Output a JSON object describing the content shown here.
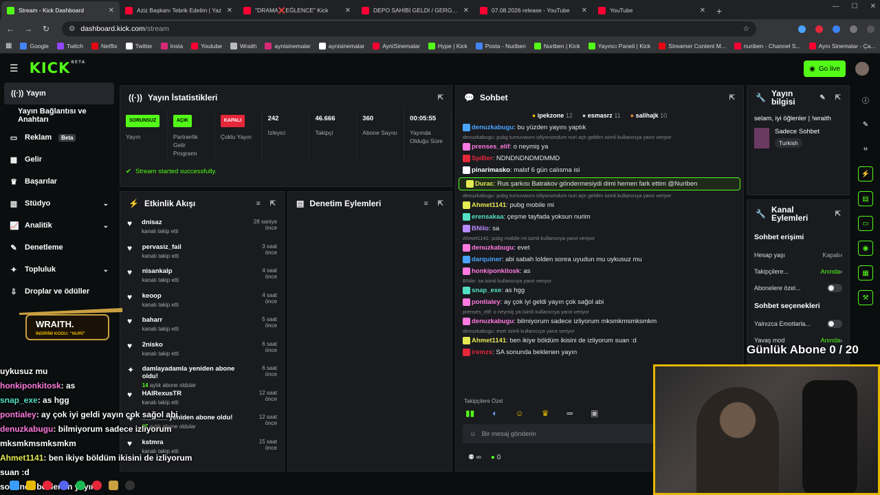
{
  "browser": {
    "tabs": [
      {
        "title": "Stream - Kick Dashboard",
        "active": true,
        "color": "#53fc18"
      },
      {
        "title": "Aziz Başkanı Tebrik Edelim | Yaz",
        "active": false,
        "color": "#ff0033"
      },
      {
        "title": "\"DRAMA❌EĞLENCE\" Kick",
        "active": false,
        "color": "#ff0033"
      },
      {
        "title": "DEPO SAHİBİ GELDİ / GERGİNL",
        "active": false,
        "color": "#ff0033"
      },
      {
        "title": "07.08.2026 release - YouTube",
        "active": false,
        "color": "#ff0033"
      },
      {
        "title": "YouTube",
        "active": false,
        "color": "#ff0033"
      }
    ],
    "url_host": "dashboard.kick.com",
    "url_path": "/stream",
    "bookmarks": [
      {
        "label": "Google",
        "color": "#4285f4"
      },
      {
        "label": "Twitch",
        "color": "#9146ff"
      },
      {
        "label": "Netflix",
        "color": "#e50914"
      },
      {
        "label": "Twitter",
        "color": "#ffffff"
      },
      {
        "label": "Insta",
        "color": "#d62976"
      },
      {
        "label": "Youtube",
        "color": "#ff0033"
      },
      {
        "label": "Wraith",
        "color": "#bbbbbb"
      },
      {
        "label": "aynisinemalar",
        "color": "#d62976"
      },
      {
        "label": "aynisinemalar",
        "color": "#ffffff"
      },
      {
        "label": "AyniSinemalar",
        "color": "#ff0033"
      },
      {
        "label": "Hype | Kick",
        "color": "#53fc18"
      },
      {
        "label": "Posta - Nuriben",
        "color": "#4285f4"
      },
      {
        "label": "Nuriben | Kick",
        "color": "#53fc18"
      },
      {
        "label": "Yayıncı Paneli | Kick",
        "color": "#53fc18"
      },
      {
        "label": "Streamer Content M...",
        "color": "#e50914"
      },
      {
        "label": "nuriben - Channel S...",
        "color": "#ff0033"
      },
      {
        "label": "Aynı Sinemalar - Ça...",
        "color": "#ff0033"
      }
    ]
  },
  "header": {
    "logo": "KICK",
    "beta": "BETA",
    "golive": "Go live"
  },
  "sidebar": [
    {
      "label": "Yayın",
      "icon": "broadcast-icon",
      "active": true
    },
    {
      "label": "Yayın Bağlantısı ve Anahtarı",
      "icon": "",
      "active": false
    },
    {
      "label": "Reklam",
      "icon": "ad-icon",
      "badge": "Beta"
    },
    {
      "label": "Gelir",
      "icon": "revenue-icon"
    },
    {
      "label": "Başarılar",
      "icon": "trophy-icon"
    },
    {
      "label": "Stüdyo",
      "icon": "studio-icon",
      "chev": true
    },
    {
      "label": "Analitik",
      "icon": "analytics-icon",
      "chev": true
    },
    {
      "label": "Denetleme",
      "icon": "moderation-icon"
    },
    {
      "label": "Topluluk",
      "icon": "community-icon",
      "chev": true
    },
    {
      "label": "Droplar ve ödüller",
      "icon": "drops-icon"
    }
  ],
  "stats": {
    "title": "Yayın İstatistikleri",
    "items": [
      {
        "pill": "SORUNSUZ",
        "pill_color": "#53fc18",
        "label": "Yayın"
      },
      {
        "pill": "AÇIK",
        "pill_color": "#53fc18",
        "label": "Partnerlik Gelir Programı"
      },
      {
        "pill": "KAPALI",
        "pill_color": "#e5273a",
        "label": "Çoklu Yayın"
      },
      {
        "value": "242",
        "label": "İzleyici"
      },
      {
        "value": "46.666",
        "label": "Takipçi"
      },
      {
        "value": "360",
        "label": "Abone Sayısı"
      },
      {
        "value": "00:05:55",
        "label": "Yayında Olduğu Süre"
      }
    ],
    "success": "Stream started successfully."
  },
  "activity": {
    "title": "Etkinlik Akışı",
    "items": [
      {
        "name": "dnisaz",
        "sub": "kanalı takip etti",
        "time": "28 saniye önce"
      },
      {
        "name": "pervasiz_fail",
        "sub": "kanalı takip etti",
        "time": "3 saat önce"
      },
      {
        "name": "nisankalp",
        "sub": "kanalı takip etti",
        "time": "4 saat önce"
      },
      {
        "name": "keoop",
        "sub": "kanalı takip etti",
        "time": "4 saat önce"
      },
      {
        "name": "baharr",
        "sub": "kanalı takip etti",
        "time": "5 saat önce"
      },
      {
        "name": "2nisko",
        "sub": "kanalı takip etti",
        "time": "6 saat önce"
      },
      {
        "name": "damlayadamla yeniden abone oldu!",
        "sub_g": "14",
        "sub": "aylık abone oldular",
        "time": "6 saat önce"
      },
      {
        "name": "HAIRexusTR",
        "sub": "kanalı takip etti",
        "time": "12 saat önce"
      },
      {
        "name": "_______ yeniden abone oldu!",
        "sub_g": "27",
        "sub": "aylık abone oldular",
        "time": "12 saat önce"
      },
      {
        "name": "kstmra",
        "sub": "kanalı takip etti",
        "time": "15 saat önce"
      }
    ]
  },
  "moderation": {
    "title": "Denetim Eylemleri"
  },
  "chat": {
    "title": "Sohbet",
    "leaders": [
      {
        "name": "ipekzone",
        "n": "12",
        "color": "#e6b800"
      },
      {
        "name": "esmasrz",
        "n": "11",
        "color": "#cccccc"
      },
      {
        "name": "salihajk",
        "n": "10",
        "color": "#e08a3c"
      }
    ],
    "messages": [
      {
        "user": "denuzkabugu",
        "color": "#4aa3ff",
        "text": "bu yüzden yayını yaptık"
      },
      {
        "reply": "denuzkabugu: pubg turnuvasını izliyorumdum nuri açtı geldim isimli kullanıcıya yanıt veriyor"
      },
      {
        "user": "prenses_elif",
        "color": "#ff7ae0",
        "text": "o neymiş ya"
      },
      {
        "user": "SpiBer",
        "color": "#e5273a",
        "text": "NDNDNDNDMDMMD"
      },
      {
        "user": "pinarimasko",
        "color": "#ffffff",
        "text": "malsf 6 gün calısma isi"
      },
      {
        "user": "Durac",
        "color": "#e5eb52",
        "text": "Rus şarkısı Batrakov göndermesiydi dimi hemen fark ettim @Nuriben",
        "hl": true
      },
      {
        "reply": "denuzkabugu: pubg turnuvasını izliyorumdum nuri açtı geldim isimli kullanıcıya yanıt veriyor"
      },
      {
        "user": "Ahmet1141",
        "color": "#e5eb52",
        "text": "pubg mobile mi"
      },
      {
        "user": "erensakaa",
        "color": "#53e0c4",
        "text": "çeşme tayfada yoksun nurim"
      },
      {
        "user": "BNilo",
        "color": "#b98bff",
        "text": "sa"
      },
      {
        "reply": "Ahmet1141: pubg mobile mi isimli kullanıcıya yanıt veriyor"
      },
      {
        "user": "denuzkabugu",
        "color": "#ff7ae0",
        "text": "evet"
      },
      {
        "user": "darquiner",
        "color": "#4aa3ff",
        "text": "abi sabah lolden sonra uyudun mu uykusuz mu"
      },
      {
        "user": "honkiponkitosk",
        "color": "#ff7ae0",
        "text": "as"
      },
      {
        "reply": "BNilo: sa isimli kullanıcıya yanıt veriyor"
      },
      {
        "user": "snap_exe",
        "color": "#53e0c4",
        "text": "as hgg"
      },
      {
        "user": "pontialey",
        "color": "#ff7ae0",
        "text": "ay çok iyi geldi yayın çok sağol abi"
      },
      {
        "reply": "prenses_elif: o neymiş ya isimli kullanıcıya yanıt veriyor"
      },
      {
        "user": "denuzkabugu",
        "color": "#ff7ae0",
        "text": "bilmiyorum sadece izliyorum mksmkmsmksmkm"
      },
      {
        "reply": "denuzkabugu: evet isimli kullanıcıya yanıt veriyor"
      },
      {
        "user": "Ahmet1141",
        "color": "#e5eb52",
        "text": "ben ikiye böldüm ikisini de izliyorum suan :d"
      },
      {
        "user": "iremzs",
        "color": "#e5273a",
        "text": "SA sonunda beklenen yayın"
      }
    ],
    "emote_section": "Takipçilere Özel",
    "input_placeholder": "Bir mesaj gönderin",
    "footer_count": "0"
  },
  "info": {
    "title": "Yayın bilgisi",
    "stream_title": "selam, iyi öğlenler | !wraith",
    "category": "Sadece Sohbet",
    "language": "Turkish"
  },
  "channel": {
    "title": "Kanal Eylemleri",
    "chat_access": "Sohbet erişimi",
    "rows": [
      {
        "label": "Hesap yaşı",
        "val": "Kapalı",
        "type": "chev"
      },
      {
        "label": "Takipçilere...",
        "val": "Anında",
        "type": "chev",
        "green": true
      },
      {
        "label": "Abonelere özel...",
        "type": "toggle"
      }
    ],
    "chat_options": "Sohbet seçenekleri",
    "rows2": [
      {
        "label": "Yalnızca Emotlarla...",
        "type": "toggle"
      },
      {
        "label": "Yavaş mod",
        "val": "Anında",
        "type": "chev",
        "green": true
      }
    ]
  },
  "overlay": {
    "wraith_name": "WRAITH.",
    "wraith_code": "İNDİRİM KODU: \"NURİ\"",
    "goal": "Günlük Abone 0 / 20",
    "chat": [
      {
        "user": "",
        "text": "uykusuz mu",
        "color": "#ffffff"
      },
      {
        "user": "honkiponkitosk",
        "text": ": as",
        "color": "#ff7ae0"
      },
      {
        "user": "snap_exe",
        "text": ": as hgg",
        "color": "#53e0c4"
      },
      {
        "user": "pontialey",
        "text": ": ay çok iyi geldi yayın çok sağol abi",
        "color": "#ff7ae0"
      },
      {
        "user": "denuzkabugu",
        "text": ": bilmiyorum sadece izliyorum",
        "color": "#ff7ae0"
      },
      {
        "user": "",
        "text": "mksmkmsmksmkm",
        "color": "#ffffff"
      },
      {
        "user": "Ahmet1141",
        "text": ": ben ikiye böldüm ikisini de izliyorum",
        "color": "#e5eb52"
      },
      {
        "user": "",
        "text": "suan :d",
        "color": "#ffffff"
      },
      {
        "user": "",
        "text": "sonunda beklenen yayın",
        "color": "#ffffff"
      }
    ]
  }
}
